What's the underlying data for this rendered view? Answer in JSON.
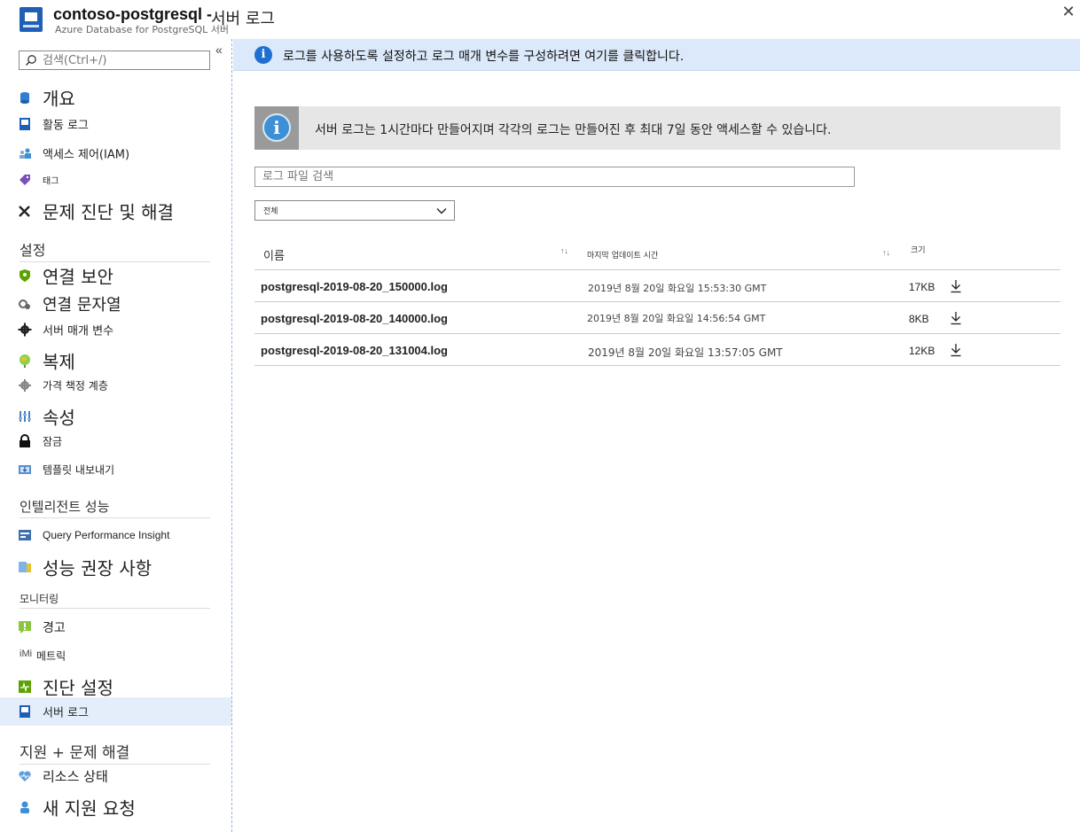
{
  "header": {
    "title": "contoso-postgresql -",
    "page": "서버 로그",
    "subtitle": "Azure Database for PostgreSQL 서버",
    "close_label": "✕"
  },
  "sidebar": {
    "collapse_label": "«",
    "search_placeholder": "검색(Ctrl+/)",
    "items": [
      {
        "label": "개요",
        "icon": "database-icon"
      },
      {
        "label": "활동 로그",
        "icon": "activity-log-icon"
      },
      {
        "label": "액세스 제어(IAM)",
        "icon": "people-icon"
      },
      {
        "label": "태그",
        "icon": "tag-icon"
      },
      {
        "label": "문제 진단 및 해결",
        "icon": "wrench-icon"
      }
    ],
    "sections": [
      {
        "title": "설정",
        "items": [
          {
            "label": "연결 보안",
            "icon": "shield-icon"
          },
          {
            "label": "연결 문자열",
            "icon": "connection-icon"
          },
          {
            "label": "서버 매개 변수",
            "icon": "gear-icon"
          },
          {
            "label": "복제",
            "icon": "globe-icon"
          },
          {
            "label": "가격 책정 계층",
            "icon": "cog-icon"
          },
          {
            "label": "속성",
            "icon": "properties-icon"
          },
          {
            "label": "잠금",
            "icon": "lock-icon"
          },
          {
            "label": "템플릿 내보내기",
            "icon": "export-icon"
          }
        ]
      },
      {
        "title": "인텔리전트 성능",
        "items": [
          {
            "label": "Query Performance Insight",
            "icon": "query-icon"
          },
          {
            "label": "성능 권장 사항",
            "icon": "recommendation-icon"
          }
        ]
      },
      {
        "title": "모니터링",
        "items": [
          {
            "label": "경고",
            "icon": "alert-icon"
          },
          {
            "label": "메트릭",
            "icon": "metrics-icon",
            "prefix": "iMi"
          },
          {
            "label": "진단 설정",
            "icon": "diagnostic-icon"
          },
          {
            "label": "서버 로그",
            "icon": "server-log-icon",
            "active": true
          }
        ]
      },
      {
        "title": "지원 + 문제 해결",
        "items": [
          {
            "label": "리소스 상태",
            "icon": "heart-icon"
          },
          {
            "label": "새 지원 요청",
            "icon": "support-icon"
          }
        ]
      }
    ]
  },
  "banner": {
    "icon": "info-icon",
    "info_glyph": "i",
    "text": "로그를 사용하도록 설정하고 로그 매개 변수를 구성하려면 여기를 클릭합니다."
  },
  "notice": {
    "icon": "info-icon",
    "info_glyph": "i",
    "text": "서버 로그는 1시간마다 만들어지며 각각의 로그는 만들어진 후 최대 7일 동안 액세스할 수 있습니다."
  },
  "log_search": {
    "placeholder": "로그 파일 검색"
  },
  "filter": {
    "value": "전체"
  },
  "table": {
    "sort_glyph": "↑↓",
    "headers": {
      "name": "이름",
      "updated": "마지막 업데이트 시간",
      "size": "크기"
    },
    "rows": [
      {
        "name": "postgresql-2019-08-20_150000.log",
        "updated": "2019년 8월 20일 화요일 15:53:30 GMT",
        "size": "17KB"
      },
      {
        "name": "postgresql-2019-08-20_140000.log",
        "updated": "2019년 8월 20일 화요일 14:56:54 GMT",
        "size": "8KB"
      },
      {
        "name": "postgresql-2019-08-20_131004.log",
        "updated": "2019년 8월 20일 화요일 13:57:05 GMT",
        "size": "12KB"
      }
    ]
  },
  "colors": {
    "accent": "#1e6fd0",
    "banner_bg": "#dce9fb",
    "active_bg": "#e3eefa"
  }
}
